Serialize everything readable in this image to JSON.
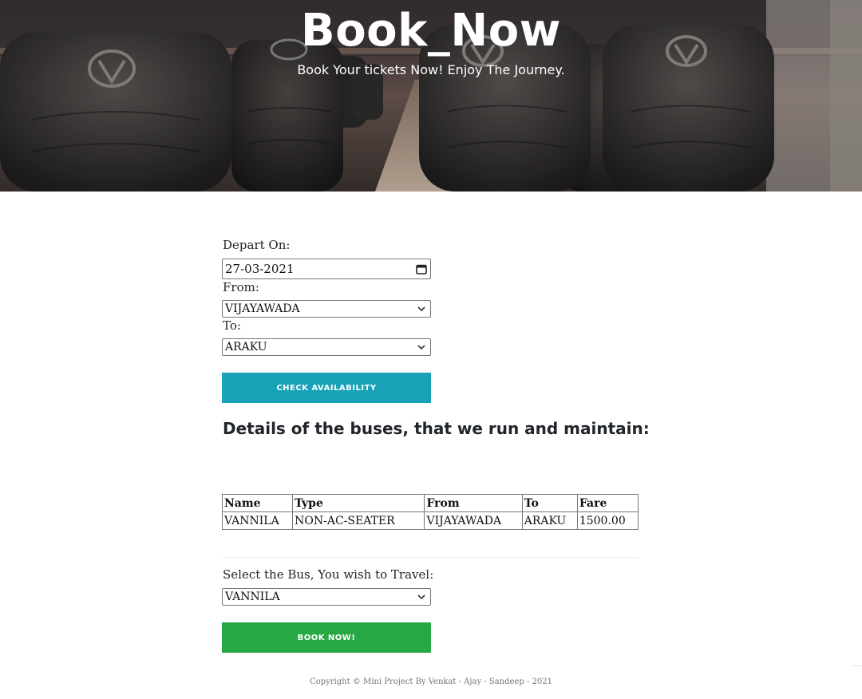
{
  "hero": {
    "title": "Book_Now",
    "subtitle": "Book Your tickets Now! Enjoy The Journey."
  },
  "form": {
    "depart": {
      "label": "Depart On:",
      "value": "27-03-2021",
      "icon": "calendar-icon"
    },
    "from": {
      "label": "From:",
      "value": "VIJAYAWADA",
      "icon": "chevron-down-icon"
    },
    "to": {
      "label": "To:",
      "value": "ARAKU",
      "icon": "chevron-down-icon"
    },
    "check_button": "CHECK AVAILABILITY"
  },
  "details": {
    "heading": "Details of the buses, that we run and maintain:",
    "columns": [
      "Name",
      "Type",
      "From",
      "To",
      "Fare"
    ],
    "rows": [
      [
        "VANNILA",
        "NON-AC-SEATER",
        "VIJAYAWADA",
        "ARAKU",
        "1500.00"
      ]
    ]
  },
  "booking": {
    "label": "Select the Bus, You wish to Travel:",
    "value": "VANNILA",
    "book_button": "BOOK NOW!"
  },
  "footer": {
    "text": "Copyright © Mini Project By Venkat - Ajay - Sandeep - 2021"
  },
  "colors": {
    "check_button": "#17a2b8",
    "book_button": "#28a745",
    "text": "#212529",
    "footer_text": "#6c757d"
  }
}
